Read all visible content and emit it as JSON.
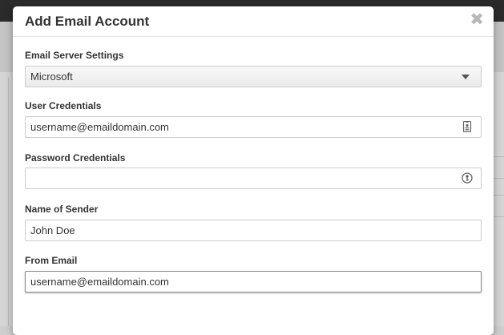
{
  "modal": {
    "title": "Add Email Account",
    "close_icon": "close-icon"
  },
  "form": {
    "server": {
      "label": "Email Server Settings",
      "selected": "Microsoft",
      "icon": "chevron-down-icon"
    },
    "user_credentials": {
      "label": "User Credentials",
      "value": "username@emaildomain.com",
      "icon": "contact-card-icon"
    },
    "password_credentials": {
      "label": "Password Credentials",
      "value": "",
      "icon": "key-icon"
    },
    "sender_name": {
      "label": "Name of Sender",
      "value": "John Doe"
    },
    "from_email": {
      "label": "From Email",
      "value": "username@emaildomain.com"
    }
  }
}
